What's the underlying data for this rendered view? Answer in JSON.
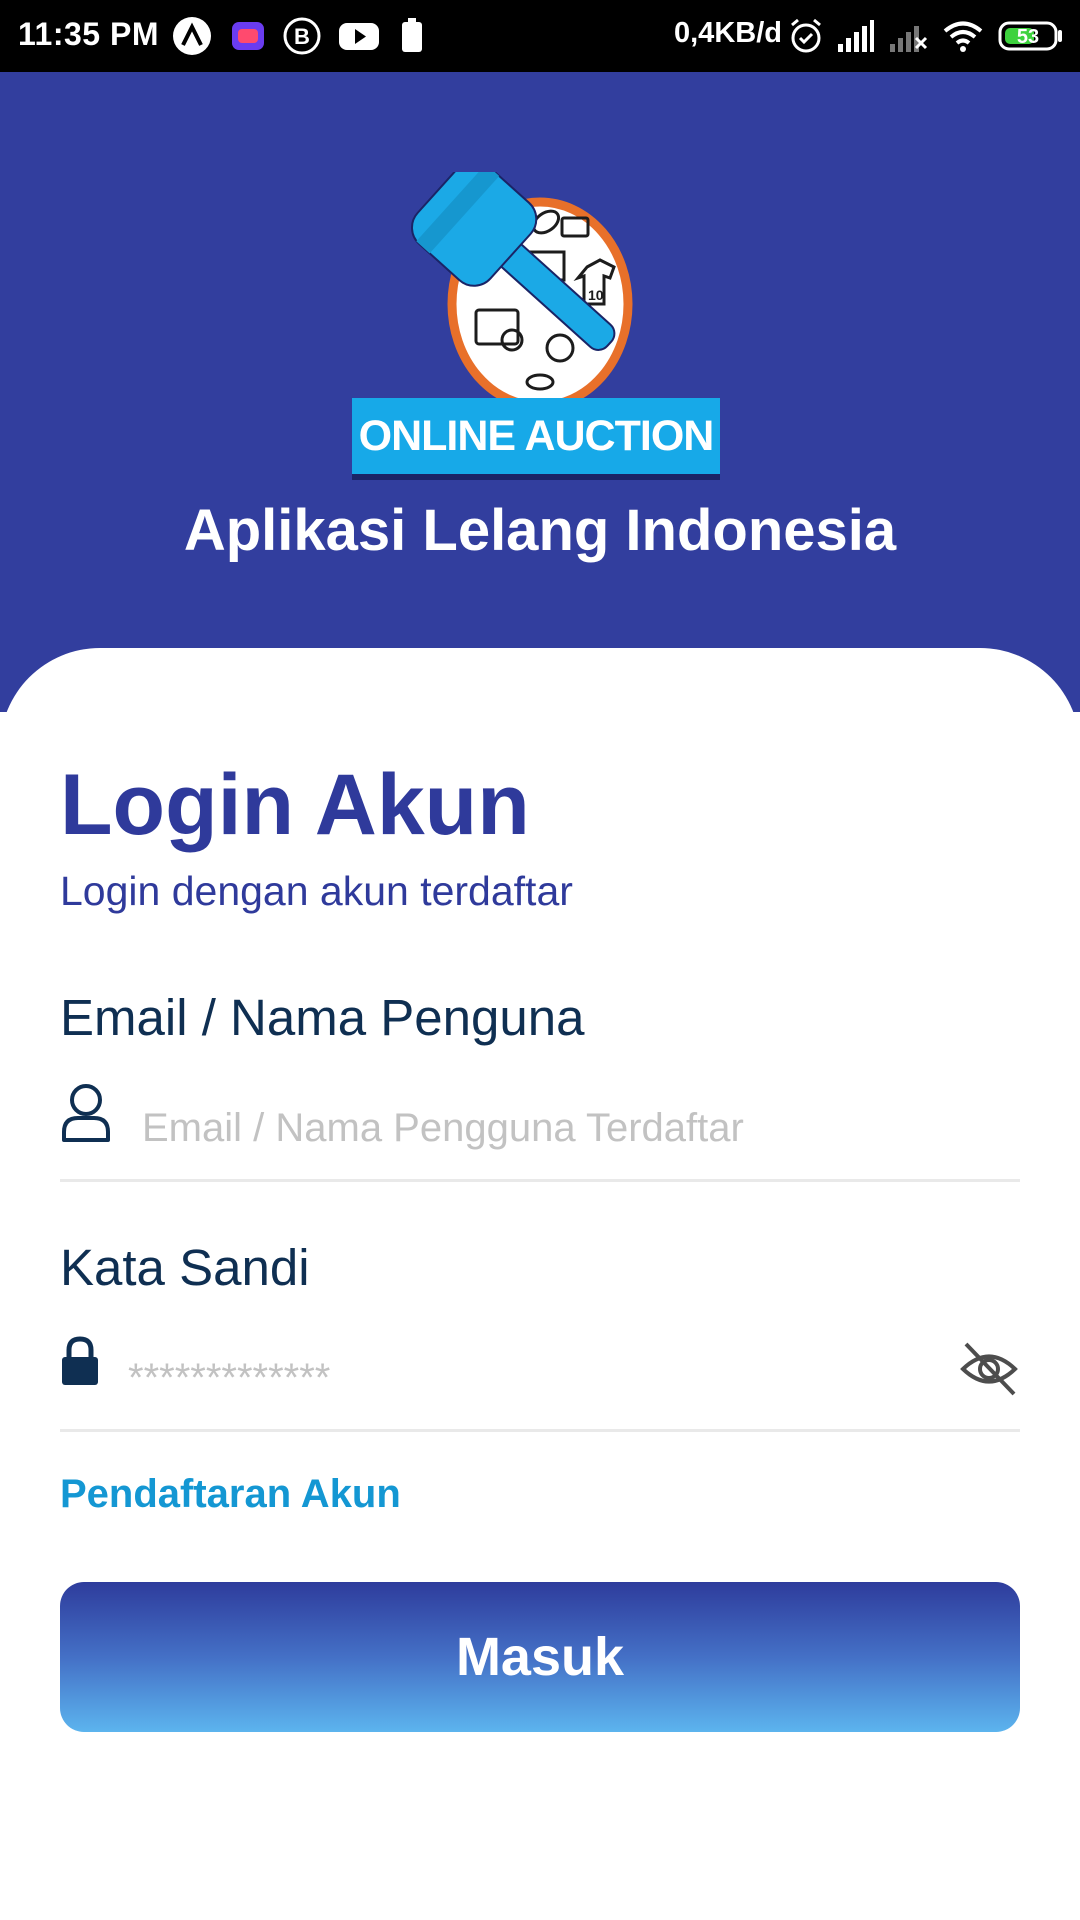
{
  "status_bar": {
    "time": "11:35 PM",
    "network_speed": "0,4KB/d",
    "battery_level": "53",
    "icons": [
      "a-icon",
      "lazada-icon",
      "b-icon",
      "youtube-icon",
      "battery-saver-icon",
      "alarm-icon",
      "signal-icon",
      "no-signal-icon",
      "wifi-icon",
      "battery-icon"
    ]
  },
  "header": {
    "logo_text": "ONLINE AUCTION",
    "app_title": "Aplikasi Lelang Indonesia",
    "background_color": "#323e9e"
  },
  "login": {
    "title": "Login Akun",
    "subtitle": "Login dengan akun terdaftar",
    "email_label": "Email / Nama Penguna",
    "email_placeholder": "Email / Nama Pengguna Terdaftar",
    "email_value": "",
    "password_label": "Kata Sandi",
    "password_placeholder": "*************",
    "password_value": "",
    "register_link": "Pendaftaran Akun",
    "submit_label": "Masuk",
    "accent_color": "#2f3a9b",
    "link_color": "#1497d3"
  }
}
